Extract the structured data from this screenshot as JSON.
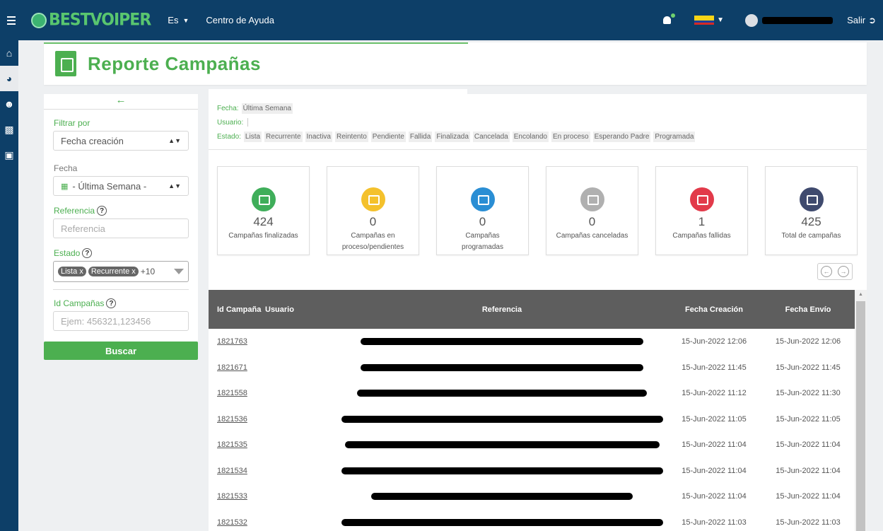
{
  "topbar": {
    "brand": "BESTVOIPER",
    "lang": "Es",
    "help_link": "Centro de Ayuda",
    "logout": "Salir"
  },
  "header": {
    "title": "Reporte Campañas"
  },
  "filter": {
    "back_arrow": "←",
    "filter_by_label": "Filtrar por",
    "filter_by_value": "Fecha creación",
    "date_label": "Fecha",
    "date_value": "- Última Semana -",
    "ref_label": "Referencia",
    "ref_placeholder": "Referencia",
    "state_label": "Estado",
    "chip1": "Lista",
    "chip2": "Recurrente",
    "chip_x": "x",
    "chip_more": "+10",
    "id_label": "Id Campañas",
    "id_placeholder": "Ejem: 456321,123456",
    "search_button": "Buscar"
  },
  "criteria": {
    "date_key": "Fecha:",
    "date_val": "Última Semana",
    "user_key": "Usuario:",
    "state_key": "Estado:",
    "states": [
      "Lista",
      "Recurrente",
      "Inactiva",
      "Reintento",
      "Pendiente",
      "Fallida",
      "Finalizada",
      "Cancelada",
      "Encolando",
      "En proceso",
      "Esperando Padre",
      "Programada"
    ]
  },
  "stats": [
    {
      "num": "424",
      "label": "Campañas finalizadas",
      "color": "#3fae5a"
    },
    {
      "num": "0",
      "label": "Campañas en proceso/pendientes",
      "color": "#f4c12c"
    },
    {
      "num": "0",
      "label": "Campañas programadas",
      "color": "#2a8ed4"
    },
    {
      "num": "0",
      "label": "Campañas canceladas",
      "color": "#b0b0b0"
    },
    {
      "num": "1",
      "label": "Campañas fallidas",
      "color": "#e23a4a"
    },
    {
      "num": "425",
      "label": "Total de campañas",
      "color": "#3f4a6e"
    }
  ],
  "table": {
    "headers": {
      "id": "Id Campaña",
      "user": "Usuario",
      "ref": "Referencia",
      "fc": "Fecha Creación",
      "fe": "Fecha Envío"
    },
    "rows": [
      {
        "id": "1821763",
        "fc": "15-Jun-2022 12:06",
        "fe": "15-Jun-2022 12:06"
      },
      {
        "id": "1821671",
        "fc": "15-Jun-2022 11:45",
        "fe": "15-Jun-2022 11:45"
      },
      {
        "id": "1821558",
        "fc": "15-Jun-2022 11:12",
        "fe": "15-Jun-2022 11:30"
      },
      {
        "id": "1821536",
        "fc": "15-Jun-2022 11:05",
        "fe": "15-Jun-2022 11:05"
      },
      {
        "id": "1821535",
        "fc": "15-Jun-2022 11:04",
        "fe": "15-Jun-2022 11:04"
      },
      {
        "id": "1821534",
        "fc": "15-Jun-2022 11:04",
        "fe": "15-Jun-2022 11:04"
      },
      {
        "id": "1821533",
        "fc": "15-Jun-2022 11:04",
        "fe": "15-Jun-2022 11:04"
      },
      {
        "id": "1821532",
        "fc": "15-Jun-2022 11:03",
        "fe": "15-Jun-2022 11:03"
      }
    ]
  }
}
